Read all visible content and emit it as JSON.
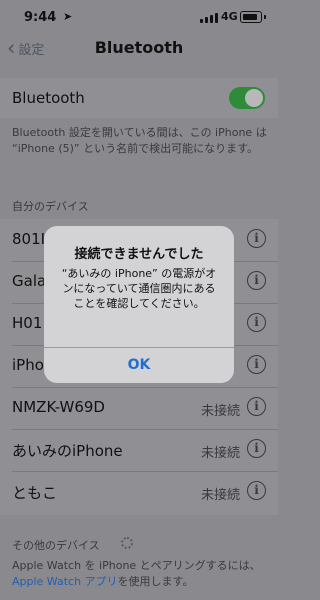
{
  "status_bar": {
    "time": "9:44",
    "network": "4G"
  },
  "nav": {
    "back_label": "設定",
    "title": "Bluetooth"
  },
  "bluetooth": {
    "label": "Bluetooth",
    "enabled": true,
    "footnote": "Bluetooth 設定を開いている間は、この iPhone は “iPhone (5)” という名前で検出可能になります。"
  },
  "my_devices": {
    "header": "自分のデバイス",
    "items": [
      {
        "name": "801I",
        "status": ""
      },
      {
        "name": "Gala",
        "status": ""
      },
      {
        "name": "H01",
        "status": ""
      },
      {
        "name": "iPho",
        "status": ""
      },
      {
        "name": "NMZK-W69D",
        "status": "未接続"
      },
      {
        "name": "あいみのiPhone",
        "status": "未接続"
      },
      {
        "name": "ともこ",
        "status": "未接続"
      }
    ]
  },
  "other_devices": {
    "header": "その他のデバイス",
    "footer_text": "Apple Watch を iPhone とペアリングするには、",
    "footer_link": "Apple Watch アプリ",
    "footer_tail": "を使用します。"
  },
  "alert": {
    "title": "接続できませんでした",
    "message": "“あいみの iPhone” の電源がオンになっていて通信圏内にあることを確認してください。",
    "button": "OK"
  },
  "colors": {
    "accent": "#1f6fd0",
    "toggle_on": "#2e8b3a",
    "dim_background": "#8a8a8e"
  }
}
